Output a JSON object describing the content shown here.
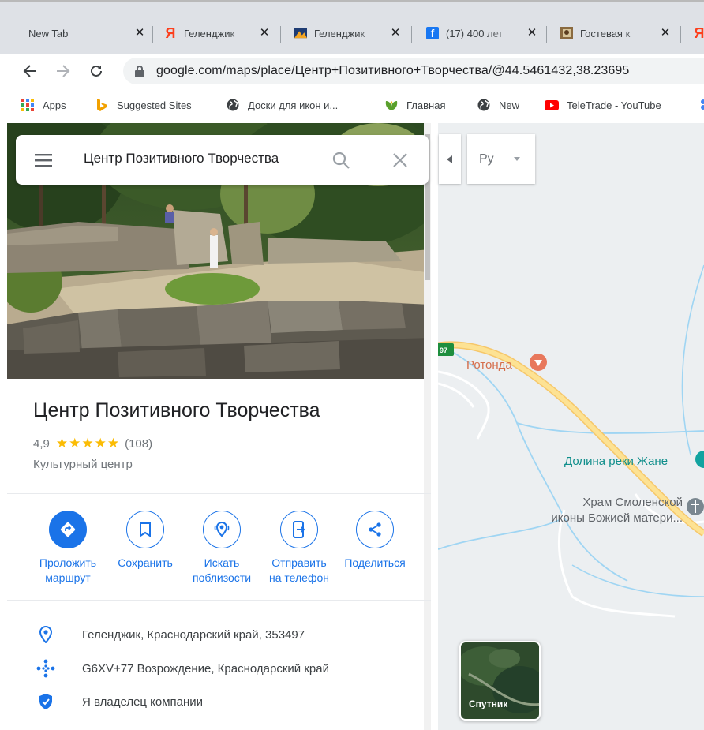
{
  "browser": {
    "tabs": [
      {
        "title": "New Tab",
        "favicon": "none"
      },
      {
        "title": "Геленджик",
        "favicon": "yandex-icon"
      },
      {
        "title": "Геленджик",
        "favicon": "picture-icon"
      },
      {
        "title": "(17) 400 лет",
        "favicon": "facebook-icon"
      },
      {
        "title": "Гостевая к",
        "favicon": "photo-icon"
      },
      {
        "title": "Я",
        "favicon": "yandex-icon"
      }
    ],
    "url": "google.com/maps/place/Центр+Позитивного+Творчества/@44.5461432,38.23695",
    "bookmarks": [
      {
        "label": "Apps",
        "icon": "apps-grid-icon"
      },
      {
        "label": "Suggested Sites",
        "icon": "bing-icon"
      },
      {
        "label": "Доски для икон и...",
        "icon": "globe-icon"
      },
      {
        "label": "Главная",
        "icon": "leaf-icon"
      },
      {
        "label": "New",
        "icon": "globe-icon"
      },
      {
        "label": "TeleTrade - YouTube",
        "icon": "youtube-icon"
      }
    ]
  },
  "search": {
    "query": "Центр Позитивного Творчества"
  },
  "place": {
    "title": "Центр Позитивного Творчества",
    "rating": "4,9",
    "stars": "★★★★★",
    "reviews": "(108)",
    "category": "Культурный центр"
  },
  "actions": [
    {
      "line1": "Проложить",
      "line2": "маршрут",
      "icon": "directions-icon"
    },
    {
      "line1": "Сохранить",
      "line2": "",
      "icon": "bookmark-icon"
    },
    {
      "line1": "Искать",
      "line2": "поблизости",
      "icon": "nearby-icon"
    },
    {
      "line1": "Отправить",
      "line2": "на телефон",
      "icon": "send-to-phone-icon"
    },
    {
      "line1": "Поделиться",
      "line2": "",
      "icon": "share-icon"
    }
  ],
  "info": [
    {
      "text": "Геленджик, Краснодарский край, 353497",
      "icon": "location-pin-icon"
    },
    {
      "text": "G6XV+77 Возрождение, Краснодарский край",
      "icon": "plus-code-icon"
    },
    {
      "text": "Я владелец компании",
      "icon": "verified-shield-icon"
    }
  ],
  "map": {
    "language_button": "Ру",
    "road_badge": "97",
    "labels": {
      "rotonda": "Ротонда",
      "valley": "Долина реки Жане",
      "church_line1": "Храм Смоленской",
      "church_line2": "иконы Божией матери..."
    },
    "satellite_label": "Спутник"
  },
  "colors": {
    "accent": "#1a73e8",
    "star": "#fbbc04",
    "poi_orange": "#e8785c",
    "poi_teal": "#12a3a0",
    "road": "#fde293"
  }
}
